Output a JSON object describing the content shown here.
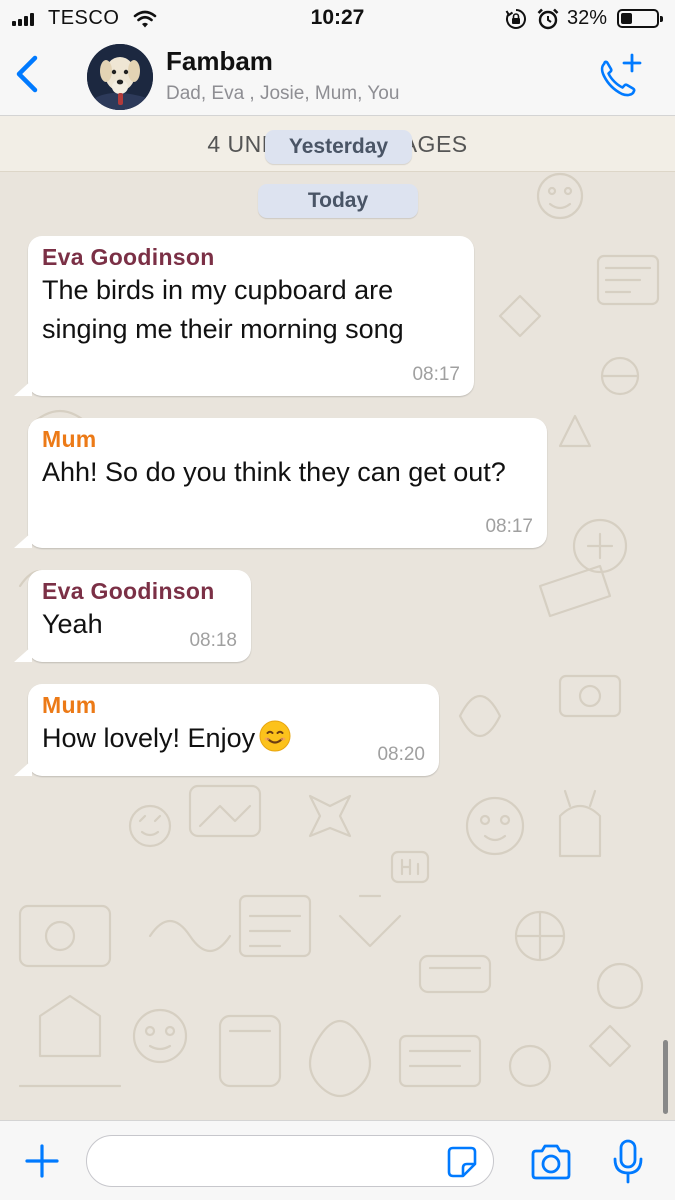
{
  "status_bar": {
    "carrier": "TESCO",
    "time": "10:27",
    "battery_percent": "32%",
    "battery_level": 0.32
  },
  "header": {
    "title": "Fambam",
    "participants": "Dad, Eva , Josie, Mum, You",
    "back_icon": "chevron-left-icon",
    "call_icon": "phone-add-icon"
  },
  "chat": {
    "unread_banner": "4 UNREAD MESSAGES",
    "date_chips": [
      "Yesterday",
      "Today"
    ],
    "messages": [
      {
        "sender": "Eva  Goodinson",
        "sender_color": "#7b3046",
        "text": "The birds in my cupboard are singing me their morning song",
        "time": "08:17"
      },
      {
        "sender": "Mum",
        "sender_color": "#ec7a17",
        "text": "Ahh! So do you think they can get out?",
        "time": "08:17"
      },
      {
        "sender": "Eva  Goodinson",
        "sender_color": "#7b3046",
        "text": "Yeah",
        "time": "08:18"
      },
      {
        "sender": "Mum",
        "sender_color": "#ec7a17",
        "text": "How lovely! Enjoy",
        "emoji": "smiling-face-icon",
        "time": "08:20"
      }
    ]
  },
  "input_bar": {
    "message_value": "",
    "icons": [
      "plus-icon",
      "sticker-icon",
      "camera-icon",
      "microphone-icon"
    ]
  },
  "colors": {
    "accent": "#007aff",
    "chat_background": "#e9e4dc",
    "bubble": "#ffffff",
    "date_chip": "#dde3f0"
  }
}
